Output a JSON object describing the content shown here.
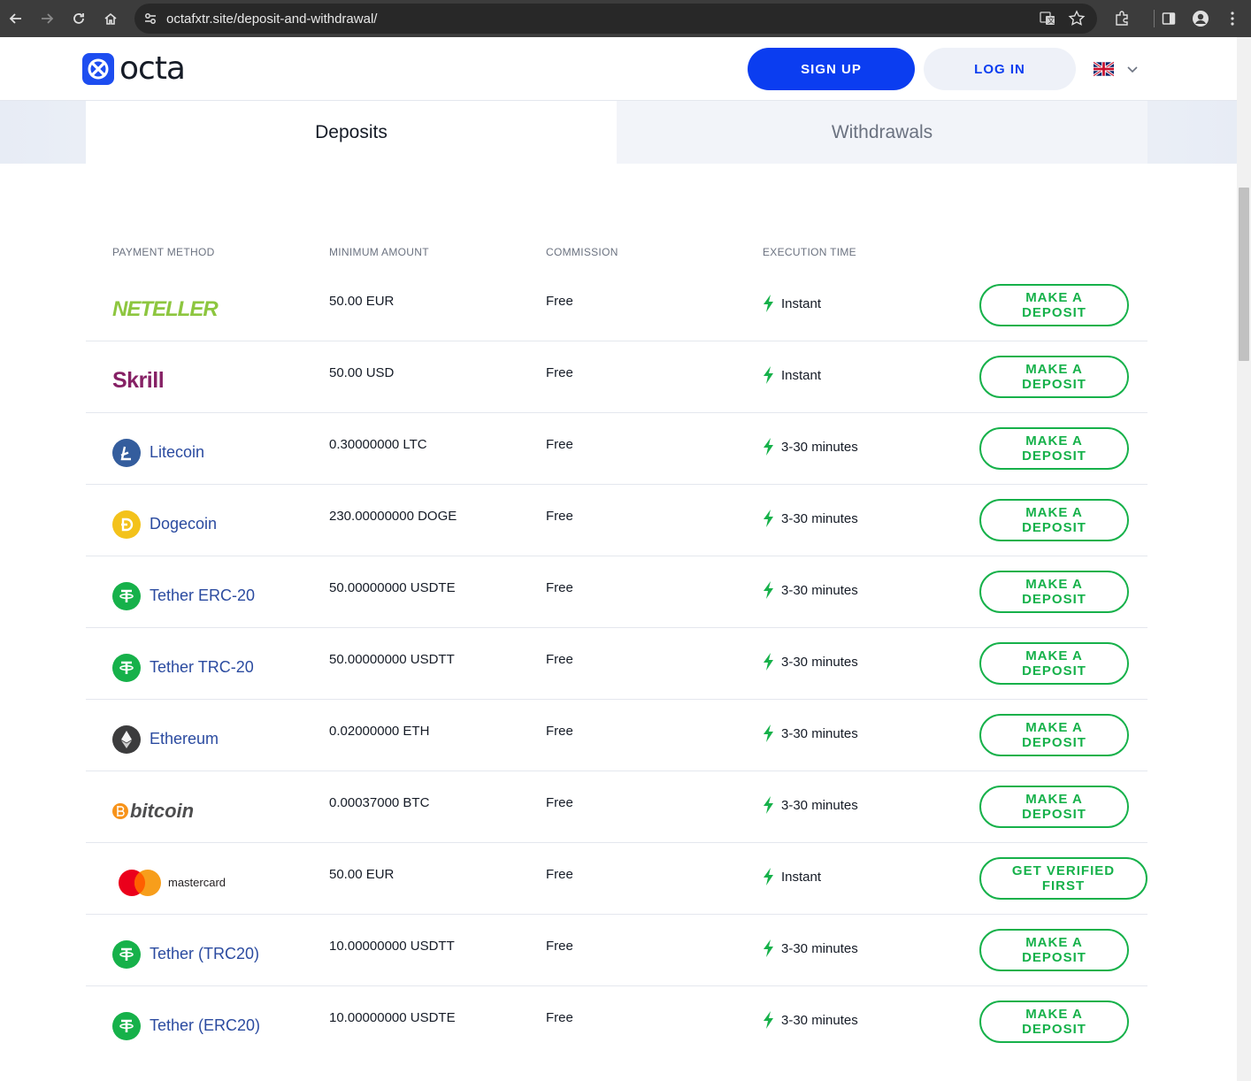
{
  "browser": {
    "url": "octafxtr.site/deposit-and-withdrawal/"
  },
  "header": {
    "logo_text": "octa",
    "signup_label": "SIGN UP",
    "login_label": "LOG IN"
  },
  "tabs": [
    {
      "label": "Deposits"
    },
    {
      "label": "Withdrawals"
    }
  ],
  "table": {
    "headers": [
      "PAYMENT METHOD",
      "MINIMUM AMOUNT",
      "COMMISSION",
      "EXECUTION TIME"
    ],
    "rows": [
      {
        "method": "NETELLER",
        "min": "50.00 EUR",
        "commission": "Free",
        "time": "Instant",
        "action": "MAKE A DEPOSIT"
      },
      {
        "method": "Skrill",
        "min": "50.00 USD",
        "commission": "Free",
        "time": "Instant",
        "action": "MAKE A DEPOSIT"
      },
      {
        "method": "Litecoin",
        "min": "0.30000000 LTC",
        "commission": "Free",
        "time": "3-30 minutes",
        "action": "MAKE A DEPOSIT"
      },
      {
        "method": "Dogecoin",
        "min": "230.00000000 DOGE",
        "commission": "Free",
        "time": "3-30 minutes",
        "action": "MAKE A DEPOSIT"
      },
      {
        "method": "Tether ERC-20",
        "min": "50.00000000 USDTE",
        "commission": "Free",
        "time": "3-30 minutes",
        "action": "MAKE A DEPOSIT"
      },
      {
        "method": "Tether TRC-20",
        "min": "50.00000000 USDTT",
        "commission": "Free",
        "time": "3-30 minutes",
        "action": "MAKE A DEPOSIT"
      },
      {
        "method": "Ethereum",
        "min": "0.02000000 ETH",
        "commission": "Free",
        "time": "3-30 minutes",
        "action": "MAKE A DEPOSIT"
      },
      {
        "method": "bitcoin",
        "min": "0.00037000 BTC",
        "commission": "Free",
        "time": "3-30 minutes",
        "action": "MAKE A DEPOSIT"
      },
      {
        "method": "mastercard",
        "min": "50.00 EUR",
        "commission": "Free",
        "time": "Instant",
        "action": "GET VERIFIED FIRST"
      },
      {
        "method": "Tether (TRC20)",
        "min": "10.00000000 USDTT",
        "commission": "Free",
        "time": "3-30 minutes",
        "action": "MAKE A DEPOSIT"
      },
      {
        "method": "Tether (ERC20)",
        "min": "10.00000000 USDTE",
        "commission": "Free",
        "time": "3-30 minutes",
        "action": "MAKE A DEPOSIT"
      }
    ]
  },
  "colors": {
    "brand_blue": "#0b3df0",
    "action_green": "#16b14a",
    "neteller_green": "#8dc63f",
    "skrill_purple": "#862165",
    "litecoin_blue": "#345d9d",
    "dogecoin_yellow": "#f3c21b",
    "tether_green": "#16b14a",
    "ethereum_dark": "#3c3c3d",
    "bitcoin_orange": "#f7931a"
  }
}
